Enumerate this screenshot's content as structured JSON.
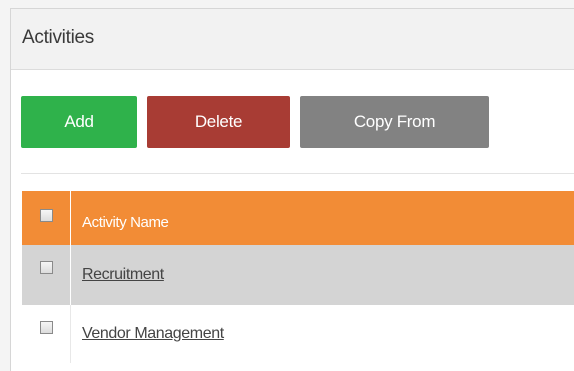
{
  "panel": {
    "title": "Activities"
  },
  "toolbar": {
    "add_label": "Add",
    "delete_label": "Delete",
    "copy_label": "Copy From"
  },
  "table": {
    "header": {
      "name": "Activity Name"
    },
    "rows": [
      {
        "name": "Recruitment"
      },
      {
        "name": "Vendor Management"
      }
    ]
  },
  "colors": {
    "add": "#2fb24b",
    "delete": "#a83c34",
    "copy": "#828282",
    "header_row": "#f28c36",
    "odd_row": "#d4d4d4"
  }
}
